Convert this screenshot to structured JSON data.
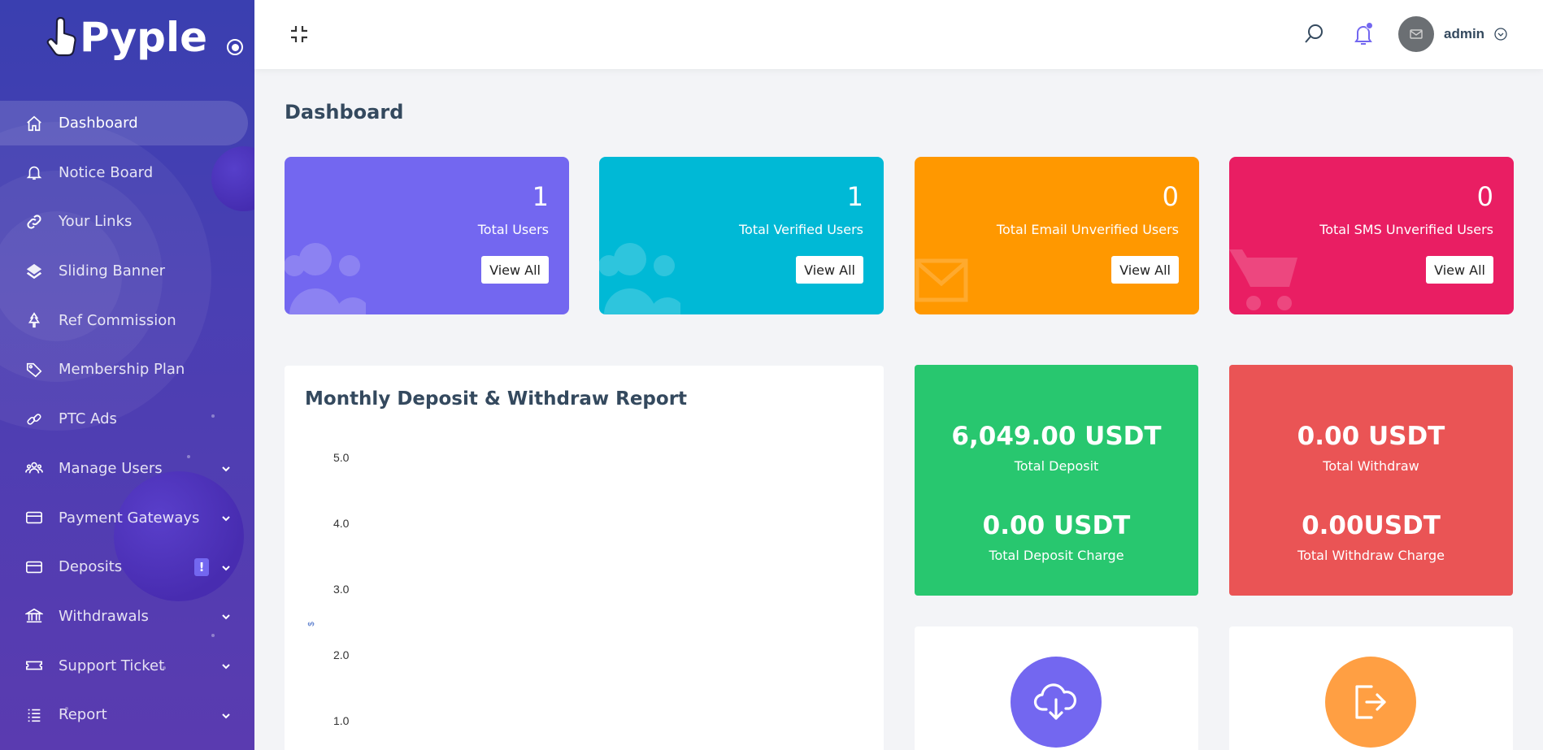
{
  "brand": {
    "name": "Pyple"
  },
  "sidebar": {
    "items": [
      {
        "label": "Dashboard",
        "icon": "home-icon",
        "active": true
      },
      {
        "label": "Notice Board",
        "icon": "bell-icon"
      },
      {
        "label": "Your Links",
        "icon": "link-icon"
      },
      {
        "label": "Sliding Banner",
        "icon": "layers-icon"
      },
      {
        "label": "Ref Commission",
        "icon": "tree-icon"
      },
      {
        "label": "Membership Plan",
        "icon": "tag-icon"
      },
      {
        "label": "PTC Ads",
        "icon": "chain-icon"
      },
      {
        "label": "Manage Users",
        "icon": "users-icon",
        "submenu": true
      },
      {
        "label": "Payment Gateways",
        "icon": "card-icon",
        "submenu": true
      },
      {
        "label": "Deposits",
        "icon": "card-icon",
        "submenu": true,
        "badge": "!"
      },
      {
        "label": "Withdrawals",
        "icon": "bank-icon",
        "submenu": true
      },
      {
        "label": "Support Ticket",
        "icon": "ticket-icon",
        "submenu": true
      },
      {
        "label": "Report",
        "icon": "list-icon",
        "submenu": true
      }
    ]
  },
  "topbar": {
    "username": "admin"
  },
  "page": {
    "title": "Dashboard"
  },
  "stats": [
    {
      "value": "1",
      "label": "Total Users",
      "button": "View All",
      "color": "#7367f0",
      "icon": "users-icon"
    },
    {
      "value": "1",
      "label": "Total Verified Users",
      "button": "View All",
      "color": "#00b9d6",
      "icon": "users-icon"
    },
    {
      "value": "0",
      "label": "Total Email Unverified Users",
      "button": "View All",
      "color": "#ff9800",
      "icon": "envelope-icon"
    },
    {
      "value": "0",
      "label": "Total SMS Unverified Users",
      "button": "View All",
      "color": "#e91e63",
      "icon": "cart-icon"
    }
  ],
  "report": {
    "title": "Monthly Deposit & Withdraw Report"
  },
  "chart_data": {
    "type": "bar",
    "title": "Monthly Deposit & Withdraw Report",
    "ylabel": "$",
    "yticks": [
      "5.0",
      "4.0",
      "3.0",
      "2.0",
      "1.0"
    ],
    "series": []
  },
  "money": [
    {
      "amount": "6,049.00 USDT",
      "label": "Total Deposit",
      "amount2": "0.00 USDT",
      "label2": "Total Deposit Charge",
      "color": "#28c76f"
    },
    {
      "amount": "0.00 USDT",
      "label": "Total Withdraw",
      "amount2": "0.00USDT",
      "label2": "Total Withdraw Charge",
      "color": "#ea5455"
    }
  ],
  "actions": [
    {
      "icon": "cloud-download-icon",
      "color": "#7367f0"
    },
    {
      "icon": "sign-out-icon",
      "color": "#ff9f43"
    }
  ]
}
